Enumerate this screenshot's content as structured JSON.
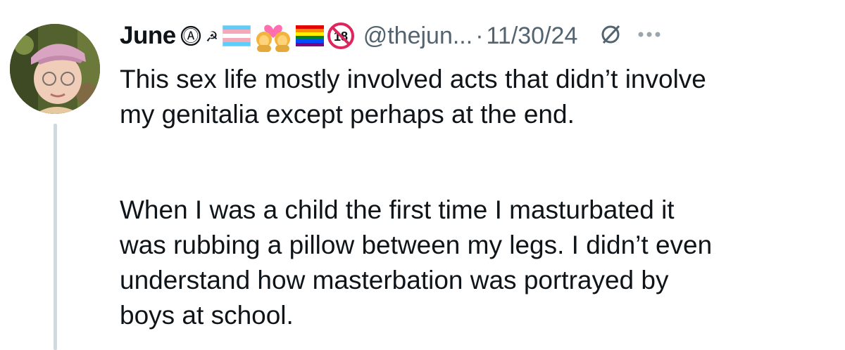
{
  "tweet": {
    "display_name": "June",
    "handle": "@thejun...",
    "separator": "·",
    "date": "11/30/24",
    "badges": [
      "anarchy-circle-a-icon",
      "hammer-sickle-icon",
      "transgender-flag-icon",
      "couple-with-heart-women-icon",
      "rainbow-flag-icon",
      "no-one-under-eighteen-icon"
    ],
    "badge_texts": {
      "anarchy": "Ⓐ",
      "hammer_sickle": "☭",
      "under_18": "18"
    },
    "edited_icon": "edited-slashed-circle-icon",
    "more_icon": "more-dots-icon",
    "avatar_icon": "profile-photo-avatar",
    "paragraphs": [
      {
        "lines": [
          "This sex life mostly involved acts that didn’t involve",
          "my genitalia except perhaps at the end."
        ]
      },
      {
        "lines": [
          "When I was a child the first time I masturbated it",
          "was rubbing a pillow between my legs. I didn’t even",
          "understand how masterbation was portrayed by",
          "boys at school."
        ]
      }
    ],
    "colors": {
      "text": "#0f1419",
      "secondary": "#536471",
      "thread_line": "#cfd9de",
      "trans_blue": "#5bcefa",
      "trans_pink": "#f5a9b8"
    }
  }
}
